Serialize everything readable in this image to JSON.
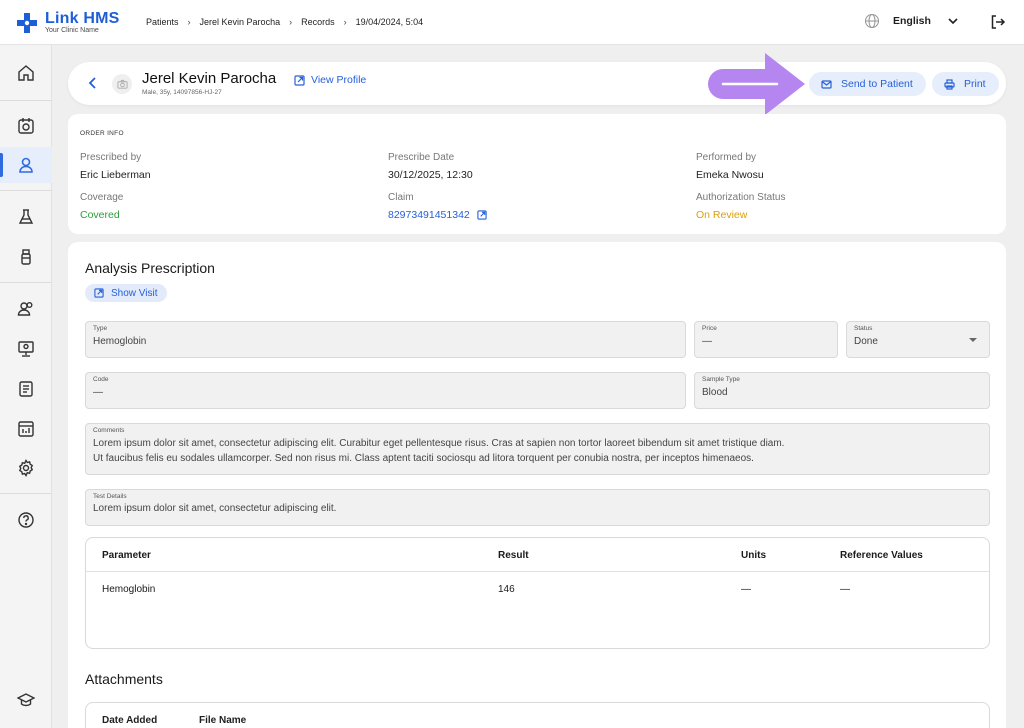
{
  "app": {
    "name": "Link HMS",
    "subtitle": "Your Clinic Name"
  },
  "breadcrumb": [
    "Patients",
    "Jerel Kevin Parocha",
    "Records",
    "19/04/2024, 5:04"
  ],
  "language": "English",
  "sidebar": {
    "items": [
      {
        "icon": "home-icon"
      },
      {
        "icon": "calendar-icon"
      },
      {
        "icon": "user-icon",
        "active": true
      },
      {
        "icon": "flask-icon"
      },
      {
        "icon": "bottle-icon"
      },
      {
        "icon": "users-icon"
      },
      {
        "icon": "monitor-icon"
      },
      {
        "icon": "clipboard-icon"
      },
      {
        "icon": "report-icon"
      },
      {
        "icon": "gear-icon"
      },
      {
        "icon": "help-icon"
      },
      {
        "icon": "graduation-cap-icon"
      }
    ]
  },
  "patient": {
    "name": "Jerel Kevin Parocha",
    "meta": "Male, 35y, 14097856-HJ-27",
    "view_profile": "View Profile"
  },
  "actions": {
    "send": "Send to Patient",
    "print": "Print"
  },
  "order_info": {
    "title": "ORDER INFO",
    "prescribed_by_label": "Prescribed by",
    "prescribed_by": "Eric Lieberman",
    "prescribe_date_label": "Prescribe Date",
    "prescribe_date": "30/12/2025, 12:30",
    "performed_by_label": "Performed by",
    "performed_by": "Emeka Nwosu",
    "coverage_label": "Coverage",
    "coverage": "Covered",
    "claim_label": "Claim",
    "claim": "82973491451342",
    "auth_label": "Authorization Status",
    "auth": "On Review"
  },
  "prescription": {
    "title": "Analysis Prescription",
    "show_visit": "Show Visit",
    "type_label": "Type",
    "type": "Hemoglobin",
    "price_label": "Price",
    "price": "—",
    "status_label": "Status",
    "status": "Done",
    "code_label": "Code",
    "code": "—",
    "sample_label": "Sample Type",
    "sample": "Blood",
    "comments_label": "Comments",
    "comments_line1": "Lorem ipsum dolor sit amet, consectetur adipiscing elit. Curabitur eget pellentesque risus. Cras at sapien non tortor laoreet bibendum sit amet tristique diam.",
    "comments_line2": "Ut faucibus felis eu sodales ullamcorper. Sed non risus mi. Class aptent taciti sociosqu ad litora torquent per conubia nostra, per inceptos himenaeos.",
    "test_details_label": "Test Details",
    "test_details": "Lorem ipsum dolor sit amet, consectetur adipiscing elit."
  },
  "results_table": {
    "headers": [
      "Parameter",
      "Result",
      "Units",
      "Reference Values"
    ],
    "rows": [
      [
        "Hemoglobin",
        "146",
        "—",
        "—"
      ]
    ]
  },
  "attachments": {
    "title": "Attachments",
    "headers": [
      "Date Added",
      "File Name"
    ]
  },
  "colors": {
    "brand": "#1e5ed6",
    "accent": "#2560d8",
    "covered": "#2d9c3c",
    "on_review": "#d9a10a",
    "annotation_arrow": "#b586f0"
  }
}
